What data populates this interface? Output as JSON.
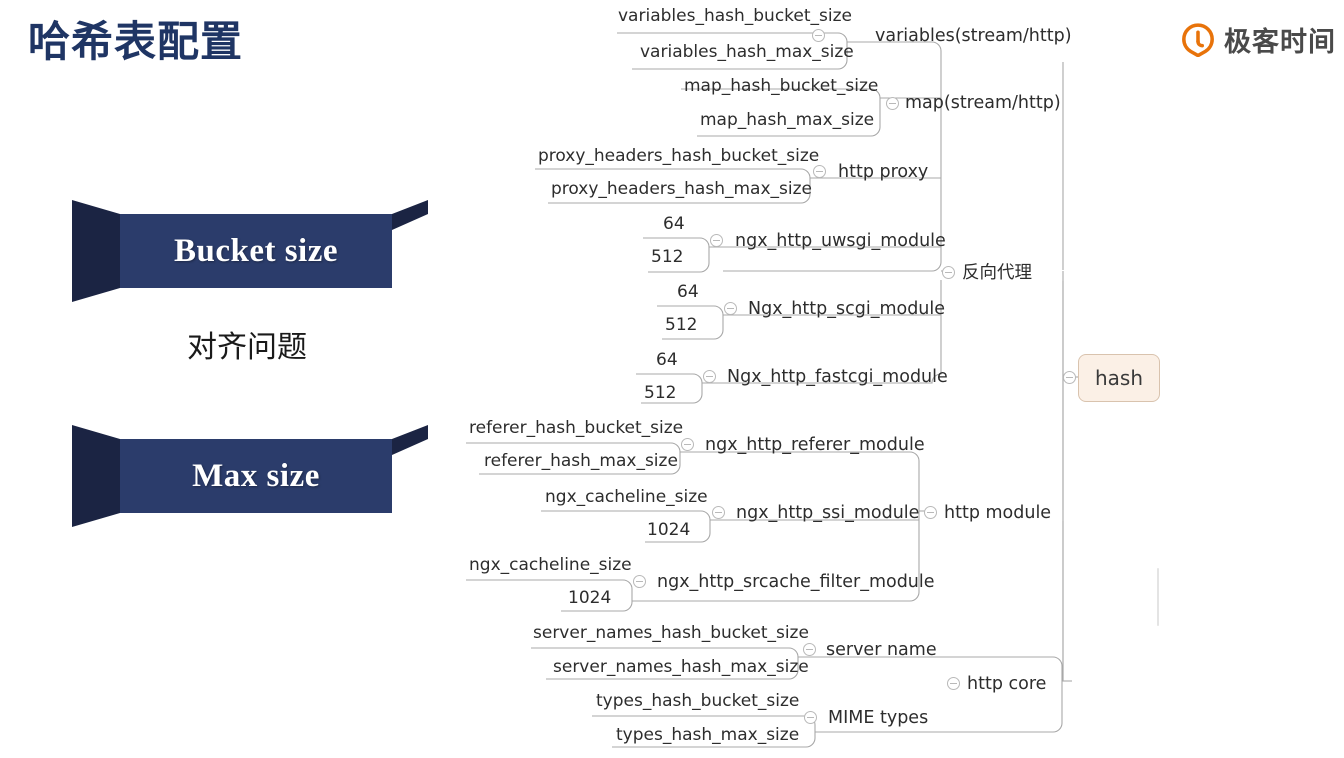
{
  "slide": {
    "title": "哈希表配置",
    "align_note": "对齐问题",
    "ribbons": [
      {
        "id": "bucket-size",
        "label": "Bucket size"
      },
      {
        "id": "max-size",
        "label": "Max size"
      }
    ]
  },
  "brand": {
    "name": "极客时间",
    "icon": "geektime-logo-icon",
    "color": "#e8730a"
  },
  "colors": {
    "title": "#1f3564",
    "ribbon_face": "#2b3c6b",
    "ribbon_fold": "#1b2443",
    "root_fill": "#fbf0e6",
    "root_border": "#d9c3ae",
    "wire": "#9a9a9a",
    "text": "#2d2d2d"
  },
  "mindmap": {
    "root": "hash",
    "branches": [
      {
        "name": "反向代理",
        "children": [
          {
            "name": "variables(stream/http)",
            "leaves": [
              "variables_hash_bucket_size",
              "variables_hash_max_size"
            ]
          },
          {
            "name": "map(stream/http)",
            "leaves": [
              "map_hash_bucket_size",
              "map_hash_max_size"
            ]
          },
          {
            "name": "http proxy",
            "leaves": [
              "proxy_headers_hash_bucket_size",
              "proxy_headers_hash_max_size"
            ]
          },
          {
            "name": "ngx_http_uwsgi_module",
            "leaves": [
              "64",
              "512"
            ]
          },
          {
            "name": "Ngx_http_scgi_module",
            "leaves": [
              "64",
              "512"
            ]
          },
          {
            "name": "Ngx_http_fastcgi_module",
            "leaves": [
              "64",
              "512"
            ]
          }
        ]
      },
      {
        "name": "http module",
        "children": [
          {
            "name": "ngx_http_referer_module",
            "leaves": [
              "referer_hash_bucket_size",
              "referer_hash_max_size"
            ]
          },
          {
            "name": "ngx_http_ssi_module",
            "leaves": [
              "ngx_cacheline_size",
              "1024"
            ]
          },
          {
            "name": "ngx_http_srcache_filter_module",
            "leaves": [
              "ngx_cacheline_size",
              "1024"
            ]
          }
        ]
      },
      {
        "name": "http core",
        "children": [
          {
            "name": "server name",
            "leaves": [
              "server_names_hash_bucket_size",
              "server_names_hash_max_size"
            ]
          },
          {
            "name": "MIME types",
            "leaves": [
              "types_hash_bucket_size",
              "types_hash_max_size"
            ]
          }
        ]
      }
    ],
    "nodes": {
      "l3_labels": [
        "variables_hash_bucket_size",
        "variables_hash_max_size",
        "map_hash_bucket_size",
        "map_hash_max_size",
        "proxy_headers_hash_bucket_size",
        "proxy_headers_hash_max_size",
        "64",
        "512",
        "64",
        "512",
        "64",
        "512",
        "referer_hash_bucket_size",
        "referer_hash_max_size",
        "ngx_cacheline_size",
        "1024",
        "ngx_cacheline_size",
        "1024",
        "server_names_hash_bucket_size",
        "server_names_hash_max_size",
        "types_hash_bucket_size",
        "types_hash_max_size"
      ],
      "l2_labels": [
        "variables(stream/http)",
        "map(stream/http)",
        "http proxy",
        "ngx_http_uwsgi_module",
        "Ngx_http_scgi_module",
        "Ngx_http_fastcgi_module",
        "ngx_http_referer_module",
        "ngx_http_ssi_module",
        "ngx_http_srcache_filter_module",
        "server name",
        "MIME types"
      ],
      "l1_labels": [
        "反向代理",
        "http module",
        "http core"
      ]
    }
  }
}
